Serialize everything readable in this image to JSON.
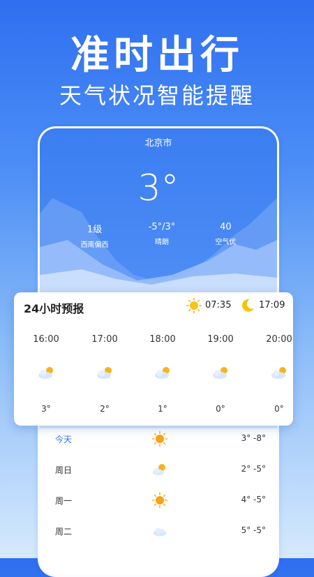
{
  "promo": {
    "headline": "准时出行",
    "subline": "天气状况智能提醒"
  },
  "current": {
    "city": "北京市",
    "temperature": "3°",
    "stats": [
      {
        "value": "1级",
        "label": "西南偏西"
      },
      {
        "value": "-5°/3°",
        "label": "晴朗"
      },
      {
        "value": "40",
        "label": "空气优"
      }
    ]
  },
  "hourly_card": {
    "title": "24小时预报",
    "sunrise": "07:35",
    "sunset": "17:09",
    "hours": [
      {
        "time": "16:00",
        "icon": "partly-cloudy-icon",
        "temp": "3°"
      },
      {
        "time": "17:00",
        "icon": "partly-cloudy-icon",
        "temp": "2°"
      },
      {
        "time": "18:00",
        "icon": "partly-cloudy-icon",
        "temp": "1°"
      },
      {
        "time": "19:00",
        "icon": "partly-cloudy-icon",
        "temp": "0°"
      },
      {
        "time": "20:00",
        "icon": "partly-cloudy-icon",
        "temp": "0°"
      }
    ]
  },
  "daily": [
    {
      "day": "今天",
      "icon": "sun-icon",
      "temps": "3° -8°"
    },
    {
      "day": "周日",
      "icon": "partly-cloudy-icon",
      "temps": "2° -5°"
    },
    {
      "day": "周一",
      "icon": "sun-icon",
      "temps": "4° -5°"
    },
    {
      "day": "周二",
      "icon": "cloud-icon",
      "temps": "5° -5°"
    }
  ],
  "colors": {
    "accent": "#2f6ff0",
    "sun": "#f7b31e",
    "moon": "#f5c400"
  }
}
